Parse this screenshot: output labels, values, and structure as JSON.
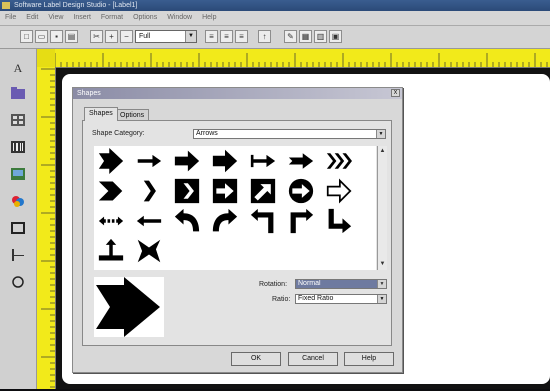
{
  "window": {
    "title": "Software Label Design Studio - [Label1]"
  },
  "menu": [
    "File",
    "Edit",
    "View",
    "Insert",
    "Format",
    "Options",
    "Window",
    "Help"
  ],
  "toolbar": {
    "zoom": "Full"
  },
  "dialog": {
    "title": "Shapes",
    "close_label": "x",
    "tabs": [
      "Shapes",
      "Options"
    ],
    "category_label": "Shape Category:",
    "category_value": "Arrows",
    "rotation_label": "Rotation:",
    "rotation_value": "Normal",
    "ratio_label": "Ratio:",
    "ratio_value": "Fixed Ratio",
    "ok_label": "OK",
    "cancel_label": "Cancel",
    "help_label": "Help"
  },
  "shapes": [
    "arrow-right-chevron-icon",
    "arrow-right-thin-icon",
    "arrow-right-icon",
    "arrow-right-bold-icon",
    "arrow-right-tailed-icon",
    "arrow-right-notched-icon",
    "arrow-double-chevron-icon",
    "chevron-right-icon",
    "chevron-thin-icon",
    "chevron-box-icon",
    "arrow-box-right-icon",
    "arrow-box-diagonal-icon",
    "arrow-circle-right-icon",
    "arrow-outline-right-icon",
    "arrow-double-dashed-icon",
    "arrow-left-thin-icon",
    "arrow-curved-left-icon",
    "arrow-curved-right-icon",
    "arrow-elbow-left-icon",
    "arrow-elbow-right-icon",
    "arrow-elbow-down-right-icon",
    "arrow-up-base-icon",
    "arrow-cross-icon"
  ],
  "colors": {
    "ruler": "#f2ea1a",
    "canvas": "#121212",
    "title": "#2b4a78",
    "selection": "#6e7aa0"
  }
}
